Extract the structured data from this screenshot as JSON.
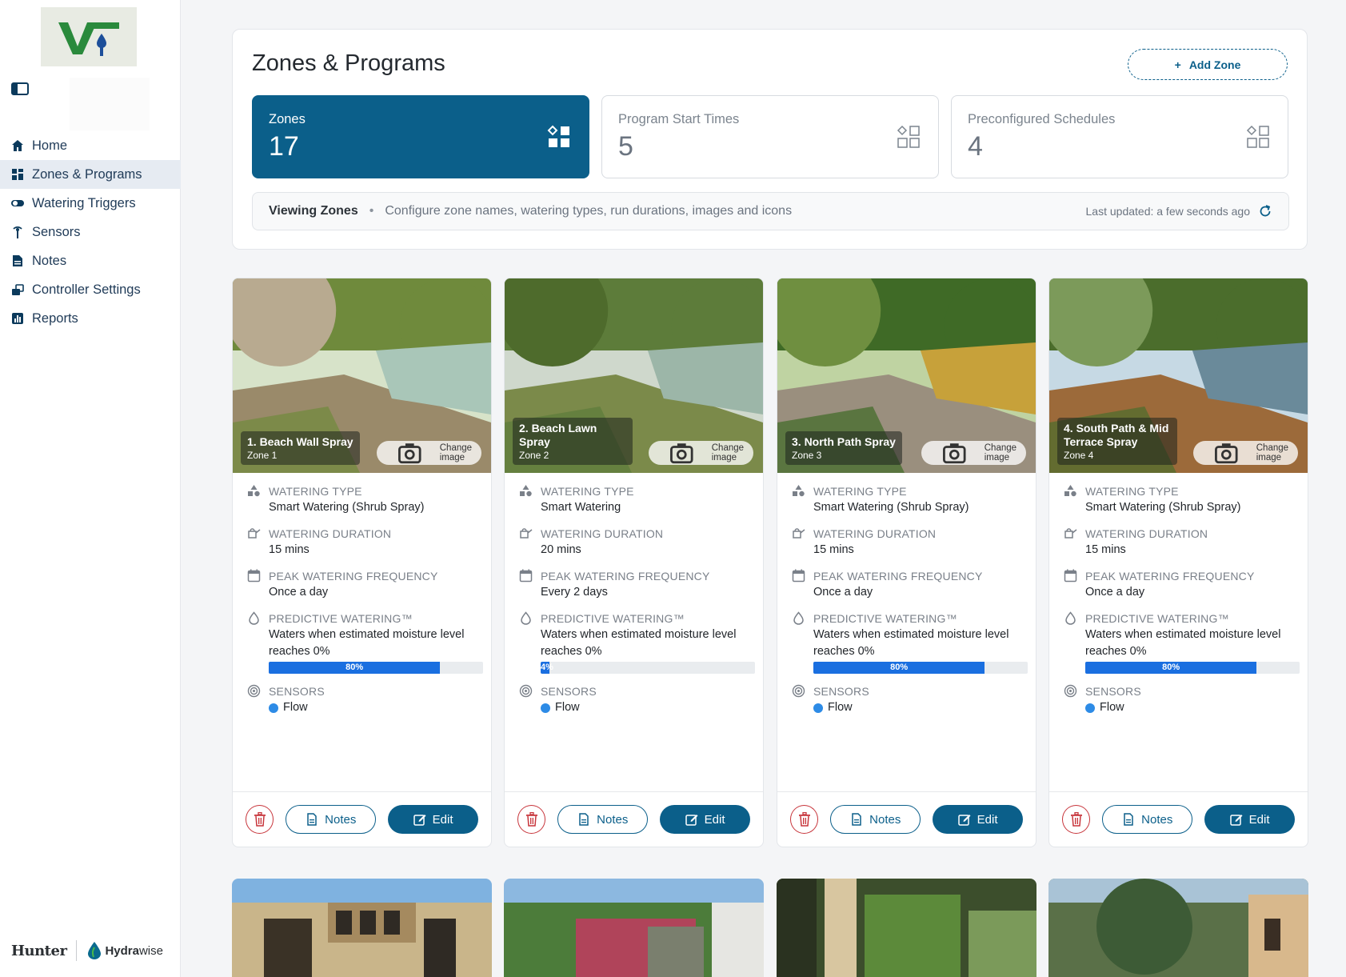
{
  "sidebar": {
    "nav": [
      {
        "label": "Home",
        "icon": "home-icon"
      },
      {
        "label": "Zones & Programs",
        "icon": "zones-icon",
        "active": true
      },
      {
        "label": "Watering Triggers",
        "icon": "toggle-icon"
      },
      {
        "label": "Sensors",
        "icon": "sensor-icon"
      },
      {
        "label": "Notes",
        "icon": "notes-icon"
      },
      {
        "label": "Controller Settings",
        "icon": "controller-icon"
      },
      {
        "label": "Reports",
        "icon": "reports-icon"
      }
    ],
    "footer": {
      "hunter": "Hunter",
      "hydra_a": "Hydra",
      "hydra_b": "wise"
    }
  },
  "header": {
    "title": "Zones & Programs",
    "add_zone": "Add Zone",
    "stats": [
      {
        "label": "Zones",
        "value": "17"
      },
      {
        "label": "Program Start Times",
        "value": "5"
      },
      {
        "label": "Preconfigured Schedules",
        "value": "4"
      }
    ],
    "viewing_title": "Viewing Zones",
    "viewing_desc": "Configure zone names, watering types, run durations, images and icons",
    "last_updated": "Last updated: a few seconds ago"
  },
  "labels": {
    "watering_type": "WATERING TYPE",
    "watering_duration": "WATERING DURATION",
    "peak_frequency": "PEAK WATERING FREQUENCY",
    "predictive": "PREDICTIVE WATERING™",
    "sensors": "SENSORS",
    "change_image": "Change image",
    "notes": "Notes",
    "edit": "Edit"
  },
  "zones": [
    {
      "name": "1. Beach Wall Spray",
      "sub": "Zone 1",
      "type": "Smart Watering (Shrub Spray)",
      "duration": "15 mins",
      "frequency": "Once a day",
      "predictive": "Waters when estimated moisture level reaches 0%",
      "moisture_pct": 80,
      "moisture_label": "80%",
      "sensor": "Flow"
    },
    {
      "name": "2. Beach Lawn Spray",
      "sub": "Zone 2",
      "type": "Smart Watering",
      "duration": "20 mins",
      "frequency": "Every 2 days",
      "predictive": "Waters when estimated moisture level reaches 0%",
      "moisture_pct": 4,
      "moisture_label": "4%",
      "sensor": "Flow"
    },
    {
      "name": "3. North Path Spray",
      "sub": "Zone 3",
      "type": "Smart Watering (Shrub Spray)",
      "duration": "15 mins",
      "frequency": "Once a day",
      "predictive": "Waters when estimated moisture level reaches 0%",
      "moisture_pct": 80,
      "moisture_label": "80%",
      "sensor": "Flow"
    },
    {
      "name": "4. South Path & Mid Terrace Spray",
      "sub": "Zone 4",
      "type": "Smart Watering (Shrub Spray)",
      "duration": "15 mins",
      "frequency": "Once a day",
      "predictive": "Waters when estimated moisture level reaches 0%",
      "moisture_pct": 80,
      "moisture_label": "80%",
      "sensor": "Flow"
    }
  ],
  "colors": {
    "primary": "#0b5f8a",
    "progress": "#1a6fe0",
    "delete": "#c7343a"
  }
}
